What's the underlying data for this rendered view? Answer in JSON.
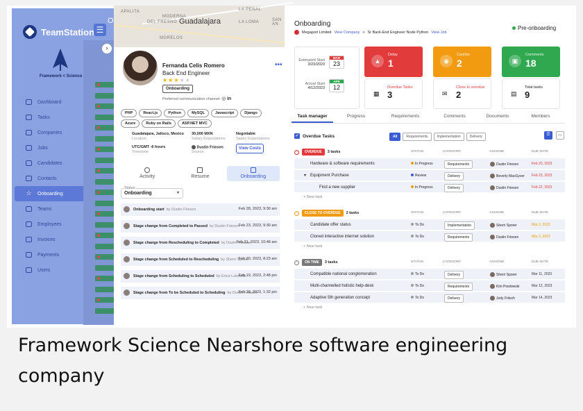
{
  "sidebar": {
    "brand": "TeamStation",
    "logo_label": "Framework < Science />",
    "items": [
      {
        "label": "Dashboard",
        "icon": "dashboard-icon"
      },
      {
        "label": "Tasks",
        "icon": "tasks-icon"
      },
      {
        "label": "Companies",
        "icon": "companies-icon"
      },
      {
        "label": "Jobs",
        "icon": "jobs-icon"
      },
      {
        "label": "Candidates",
        "icon": "candidates-icon"
      },
      {
        "label": "Contacts",
        "icon": "contacts-icon"
      },
      {
        "label": "Onboarding",
        "icon": "star-icon",
        "active": true
      },
      {
        "label": "Teams",
        "icon": "teams-icon"
      },
      {
        "label": "Employees",
        "icon": "employees-icon"
      },
      {
        "label": "Invoices",
        "icon": "invoices-icon"
      },
      {
        "label": "Payments",
        "icon": "payments-icon"
      },
      {
        "label": "Users",
        "icon": "users-icon"
      }
    ],
    "partial_header": "O"
  },
  "map": {
    "labels": [
      "APALITA",
      "MODERNA",
      "LA PENAL",
      "DEL FRESNO",
      "Guadalajara",
      "LA LOMA",
      "SAN AN",
      "MORELOS"
    ]
  },
  "profile": {
    "name": "Fernanda Celis Romero",
    "role": "Back End Engineer",
    "rating_on": "★★★",
    "rating_off": "★★",
    "badge": "Onboarding",
    "comm": "Preferred communication channel:",
    "skills": [
      "PHP",
      "React.js",
      "Python",
      "MySQL",
      "Javascript",
      "Django",
      "Azure",
      "Ruby on Rails",
      "ASP.NET MVC"
    ],
    "location": "Guadalajara, Jalisco, Mexico",
    "location_lbl": "Location",
    "timezone": "UTC/GMT -6 hours",
    "timezone_lbl": "Timezone",
    "salary": "30,000 MXN",
    "salary_lbl": "Salary Expectations",
    "source": "Dustin Friesen",
    "source_lbl": "Source",
    "negotiable": "Negotiable",
    "negotiable_lbl": "Salary Expectations",
    "view_costs": "View Costs",
    "tabs": [
      "Activity",
      "Resume",
      "Onboarding"
    ],
    "status_lbl": "Status",
    "status_val": "Onboarding",
    "activity": [
      {
        "text": "Onboarding start",
        "by": "by Dustin Friesen",
        "date": "Feb 28, 2023, 9:30 am"
      },
      {
        "text": "Stage change from Completed to Passed",
        "by": "by Dustin Friesen",
        "date": "Feb 23, 2023, 9:30 am"
      },
      {
        "text": "Stage change from Rescheduling to Completed",
        "by": "by Dustin Friesen",
        "date": "Feb 21, 2023, 10:48 am"
      },
      {
        "text": "Stage change from Scheduled to Rescheduling",
        "by": "by Sherri Sporer",
        "date": "Feb 20, 2023, 8:23 am"
      },
      {
        "text": "Stage change from Scheduling to Scheduled",
        "by": "by Erica Lubowitz",
        "date": "Feb 19, 2023, 2:48 pm"
      },
      {
        "text": "Stage change from To be Scheduled to Scheduling",
        "by": "by Dustin Friesen",
        "date": "Feb 18, 2023, 1:32 pm"
      }
    ]
  },
  "main": {
    "title": "Onboarding",
    "company": "Megaport Limited",
    "view_company": "View Company",
    "job": "Sr Back-End Engineer Node Python",
    "view_job": "View Job",
    "status": "Pre-onboarding",
    "est_lbl": "Estimated Start",
    "est_date": "3/23/2023",
    "est_month": "MAR",
    "est_day": "23",
    "act_lbl": "Actual Start",
    "act_date": "4/12/2023",
    "act_month": "APR",
    "act_day": "12",
    "kpis": [
      {
        "label": "Delay",
        "value": "1",
        "color": "#e23b3b"
      },
      {
        "label": "Caution",
        "value": "2",
        "color": "#f29b11"
      },
      {
        "label": "Comments",
        "value": "18",
        "color": "#2fa84f"
      }
    ],
    "kpis2": [
      {
        "label": "Overdue Tasks",
        "value": "3"
      },
      {
        "label": "Close to overdue",
        "value": "2"
      },
      {
        "label": "Total tasks",
        "value": "9"
      }
    ],
    "tabs": [
      "Task manager",
      "Progress",
      "Requirements",
      "Comments",
      "Documents",
      "Members"
    ],
    "overdue_label": "Overdue Tasks",
    "filters": [
      "All",
      "Requirements",
      "Implementation",
      "Delivery"
    ],
    "columns": [
      "STATUS",
      "CATEGORY",
      "ASSIGNE",
      "DUE DATE"
    ],
    "new_task": "+ New task",
    "groups": [
      {
        "tag": "OVERDUE",
        "tag_color": "#e23b3b",
        "count": "3 tasks",
        "rows": [
          {
            "name": "Hardware & software requirements",
            "status": "In Progress",
            "cat": "Requirements",
            "who": "Dustin Friesen",
            "due": "Feb 20, 2023",
            "due_color": "#e23b3b"
          },
          {
            "name": "Equipment Purchase",
            "status": "Review",
            "cat": "Delivery",
            "who": "Beverly MacGyver",
            "due": "Feb 23, 2023",
            "due_color": "#e23b3b"
          },
          {
            "name": "Find a new supplier",
            "status": "In Progress",
            "cat": "Delivery",
            "who": "Dustin Friesen",
            "due": "Feb 22, 2023",
            "due_color": "#e23b3b"
          }
        ]
      },
      {
        "tag": "CLOSE TO OVERDUE",
        "tag_color": "#f29b11",
        "count": "2 tasks",
        "rows": [
          {
            "name": "Candidate offer status",
            "status": "To Do",
            "cat": "Implementation",
            "who": "Sherri Sporer",
            "due": "Mar 2, 2023",
            "due_color": "#f29b11"
          },
          {
            "name": "Cloned interactive internet solution",
            "status": "To Do",
            "cat": "Requirements",
            "who": "Dustin Friesen",
            "due": "Mar 2, 2023",
            "due_color": "#f29b11"
          }
        ]
      },
      {
        "tag": "ON TIME",
        "tag_color": "#777777",
        "count": "3 tasks",
        "rows": [
          {
            "name": "Compatible national conglomeration",
            "status": "To Do",
            "cat": "Delivery",
            "who": "Sherri Sporer",
            "due": "Mar 11, 2023",
            "due_color": "#333333"
          },
          {
            "name": "Multi-channelled holistic help-desk",
            "status": "To Do",
            "cat": "Requirements",
            "who": "Kim Powlowski",
            "due": "Mar 12, 2023",
            "due_color": "#333333"
          },
          {
            "name": "Adaptive 5th generation concept",
            "status": "To Do",
            "cat": "Delivery",
            "who": "Jody Fritsch",
            "due": "Mar 14, 2023",
            "due_color": "#333333"
          }
        ]
      }
    ]
  },
  "caption": "Framework Science Nearshore software engineering company"
}
